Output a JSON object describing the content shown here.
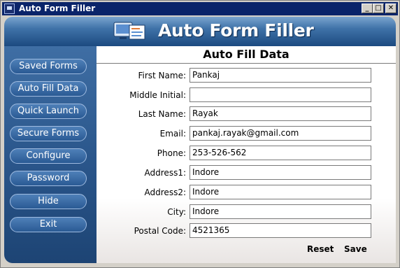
{
  "window": {
    "title": "Auto Form Filler",
    "buttons": {
      "minimize": "_",
      "maximize": "□",
      "close": "✕"
    }
  },
  "banner": {
    "title": "Auto Form Filler",
    "logo_icon": "computer-form-icon"
  },
  "sidebar": {
    "items": [
      {
        "label": "Saved Forms"
      },
      {
        "label": "Auto Fill Data"
      },
      {
        "label": "Quick Launch"
      },
      {
        "label": "Secure Forms"
      },
      {
        "label": "Configure"
      },
      {
        "label": "Password"
      },
      {
        "label": "Hide"
      },
      {
        "label": "Exit"
      }
    ]
  },
  "main": {
    "title": "Auto Fill Data",
    "fields": [
      {
        "label": "First Name:",
        "value": "Pankaj"
      },
      {
        "label": "Middle Initial:",
        "value": ""
      },
      {
        "label": "Last Name:",
        "value": "Rayak"
      },
      {
        "label": "Email:",
        "value": "pankaj.rayak@gmail.com"
      },
      {
        "label": "Phone:",
        "value": "253-526-562"
      },
      {
        "label": "Address1:",
        "value": "Indore"
      },
      {
        "label": "Address2:",
        "value": "Indore"
      },
      {
        "label": "City:",
        "value": "Indore"
      },
      {
        "label": "Postal Code:",
        "value": "4521365"
      }
    ],
    "reset_label": "Reset",
    "save_label": "Save"
  },
  "colors": {
    "titlebar": "#0a246a",
    "sidebar": "#2b578c",
    "header": "#3f72a8"
  }
}
